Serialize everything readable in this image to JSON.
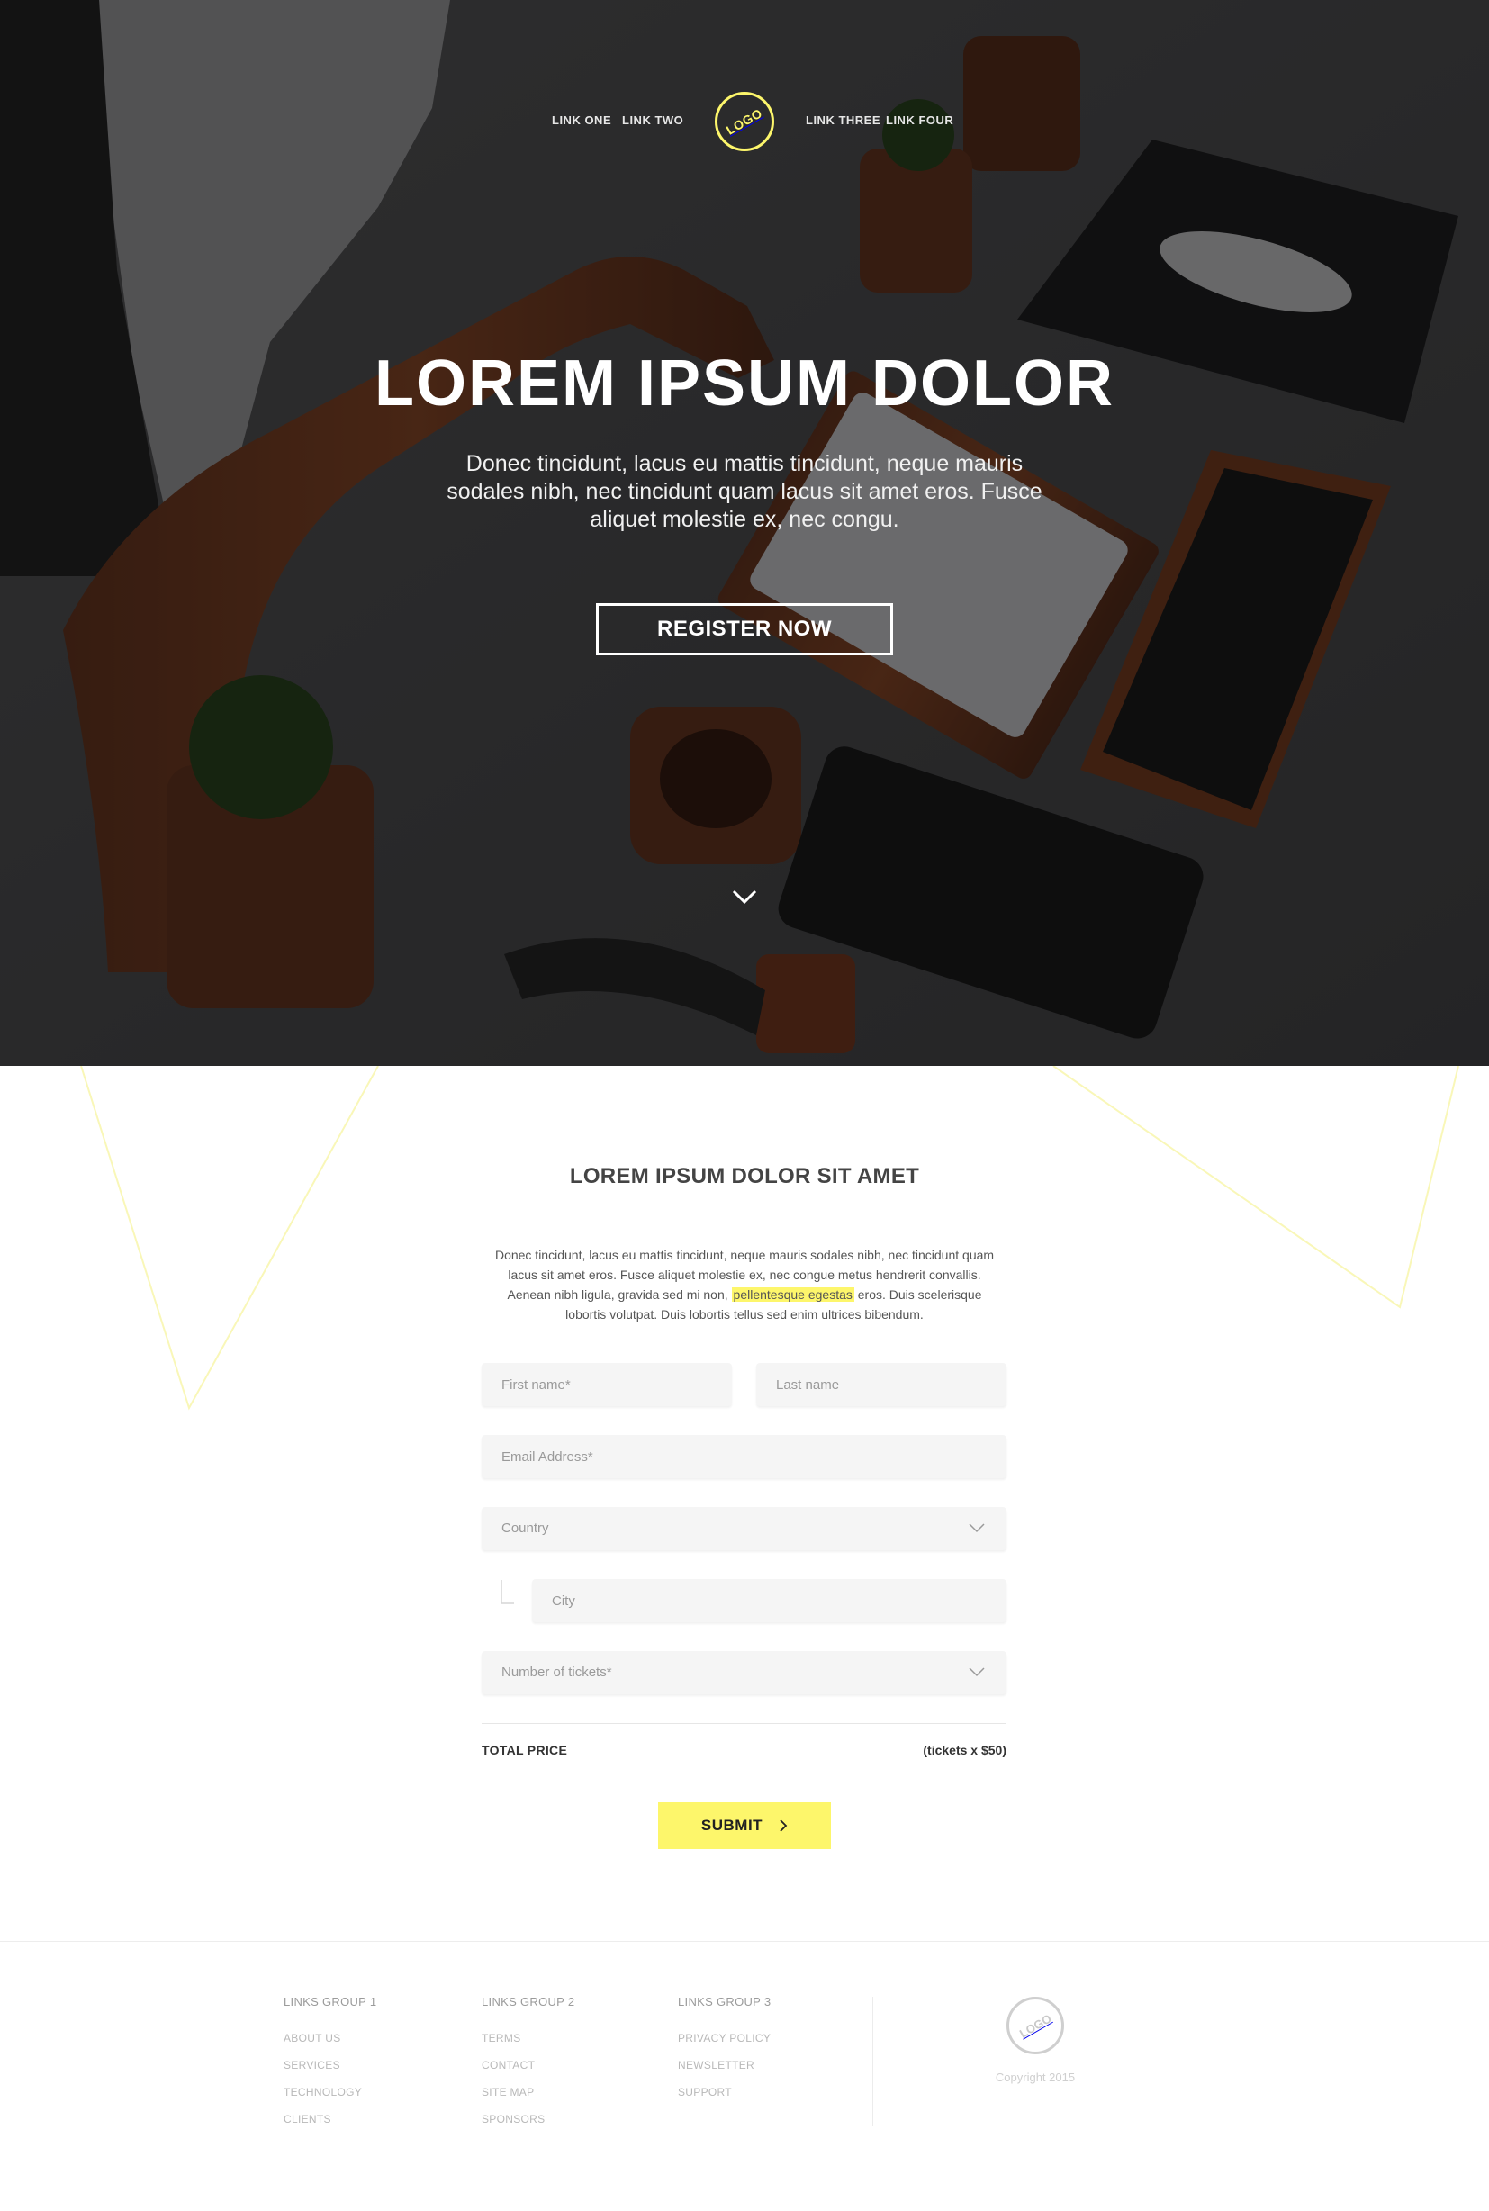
{
  "nav": {
    "links": [
      "LINK ONE",
      "LINK TWO",
      "LINK THREE",
      "LINK FOUR"
    ],
    "logo_text": "LOGO"
  },
  "hero": {
    "title": "LOREM IPSUM DOLOR",
    "subtitle": "Donec tincidunt, lacus eu mattis tincidunt, neque mauris sodales nibh, nec tincidunt quam lacus sit amet eros. Fusce aliquet molestie ex, nec congu.",
    "cta_label": "REGISTER NOW",
    "scroll_icon": "chevron-down-icon"
  },
  "form_section": {
    "title": "LOREM IPSUM DOLOR SIT AMET",
    "intro_before": "Donec tincidunt, lacus eu mattis tincidunt, neque mauris sodales nibh, nec tincidunt quam lacus sit amet eros. Fusce aliquet molestie ex, nec congue metus hendrerit convallis. Aenean nibh ligula, gravida sed mi non, ",
    "intro_highlight": "pellentesque egestas",
    "intro_after": " eros. Duis scelerisque lobortis volutpat. Duis lobortis tellus sed enim ultrices bibendum.",
    "fields": {
      "first_name": {
        "placeholder": "First name*",
        "value": ""
      },
      "last_name": {
        "placeholder": "Last name",
        "value": ""
      },
      "email": {
        "placeholder": "Email Address*",
        "value": ""
      },
      "country": {
        "placeholder": "Country"
      },
      "city": {
        "placeholder": "City",
        "value": ""
      },
      "tickets": {
        "placeholder": "Number of tickets*"
      }
    },
    "total_label": "TOTAL PRICE",
    "total_value": "(tickets x $50)",
    "submit_label": "SUBMIT"
  },
  "footer": {
    "groups": [
      {
        "heading": "LINKS GROUP 1",
        "links": [
          "ABOUT US",
          "SERVICES",
          "TECHNOLOGY",
          "CLIENTS"
        ]
      },
      {
        "heading": "LINKS GROUP 2",
        "links": [
          "TERMS",
          "CONTACT",
          "SITE MAP",
          "SPONSORS"
        ]
      },
      {
        "heading": "LINKS GROUP 3",
        "links": [
          "PRIVACY POLICY",
          "NEWSLETTER",
          "SUPPORT"
        ]
      }
    ],
    "logo_text": "LOGO",
    "copyright": "Copyright 2015"
  },
  "colors": {
    "accent_yellow": "#fdf66b",
    "hero_overlay": "#1e1e20",
    "field_bg": "#f5f5f5"
  }
}
